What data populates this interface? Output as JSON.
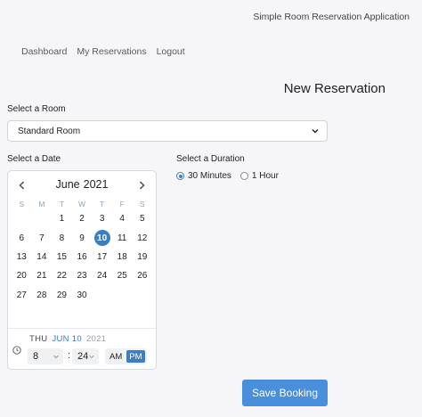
{
  "app_title": "Simple Room Reservation Application",
  "nav": {
    "items": [
      {
        "label": "Dashboard"
      },
      {
        "label": "My Reservations"
      },
      {
        "label": "Logout"
      }
    ]
  },
  "page_title": "New Reservation",
  "room": {
    "label": "Select a Room",
    "selected": "Standard Room"
  },
  "date": {
    "label": "Select a Date",
    "month": "June",
    "year": "2021",
    "weekdays": [
      "S",
      "M",
      "T",
      "W",
      "T",
      "F",
      "S"
    ],
    "weeks": [
      [
        "",
        "",
        "1",
        "2",
        "3",
        "4",
        "5"
      ],
      [
        "6",
        "7",
        "8",
        "9",
        "10",
        "11",
        "12"
      ],
      [
        "13",
        "14",
        "15",
        "16",
        "17",
        "18",
        "19"
      ],
      [
        "20",
        "21",
        "22",
        "23",
        "24",
        "25",
        "26"
      ],
      [
        "27",
        "28",
        "29",
        "30",
        "",
        "",
        ""
      ]
    ],
    "selected_day": "10",
    "footer": {
      "weekday": "THU",
      "month_day": "JUN 10",
      "year": "2021"
    },
    "time": {
      "hour": "8",
      "minute": "24",
      "am": "AM",
      "pm": "PM",
      "period": "PM"
    }
  },
  "duration": {
    "label": "Select a Duration",
    "options": [
      {
        "label": "30 Minutes",
        "checked": true
      },
      {
        "label": "1 Hour",
        "checked": false
      }
    ]
  },
  "save_button": "Save Booking"
}
